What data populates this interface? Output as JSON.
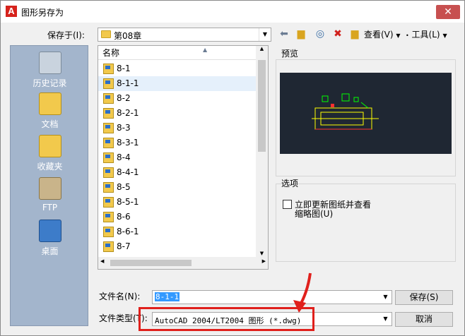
{
  "window": {
    "title": "图形另存为",
    "app_icon": "A",
    "close": "✕"
  },
  "toolbar": {
    "save_in_label": "保存于(I):",
    "save_in_value": "第08章",
    "view_label": "查看(V)",
    "tools_label": "工具(L)",
    "icons": [
      "back-arrow-icon",
      "up-folder-icon",
      "search-web-icon",
      "delete-icon",
      "new-folder-icon"
    ]
  },
  "sidebar": {
    "items": [
      {
        "label": "历史记录",
        "icon": "history-icon"
      },
      {
        "label": "文档",
        "icon": "documents-icon"
      },
      {
        "label": "收藏夹",
        "icon": "favorites-icon"
      },
      {
        "label": "FTP",
        "icon": "ftp-icon"
      },
      {
        "label": "桌面",
        "icon": "desktop-icon"
      }
    ]
  },
  "filelist": {
    "column_name": "名称",
    "rows": [
      "8-1",
      "8-1-1",
      "8-2",
      "8-2-1",
      "8-3",
      "8-3-1",
      "8-4",
      "8-4-1",
      "8-5",
      "8-5-1",
      "8-6",
      "8-6-1",
      "8-7"
    ],
    "selected_index": 1
  },
  "preview": {
    "label": "预览"
  },
  "options": {
    "label": "选项",
    "update_thumbnail_line1": "立即更新图纸并查看",
    "update_thumbnail_line2": "缩略图(U)"
  },
  "bottom": {
    "filename_label": "文件名(N):",
    "filename_value": "8-1-1",
    "filetype_label": "文件类型(T):",
    "filetype_value": "AutoCAD 2004/LT2004 图形 (*.dwg)",
    "save_button": "保存(S)",
    "cancel_button": "取消"
  },
  "colors": {
    "annotation_red": "#e0201c",
    "sidebar_bg": "#a3b5cc",
    "preview_bg": "#1f2733"
  }
}
